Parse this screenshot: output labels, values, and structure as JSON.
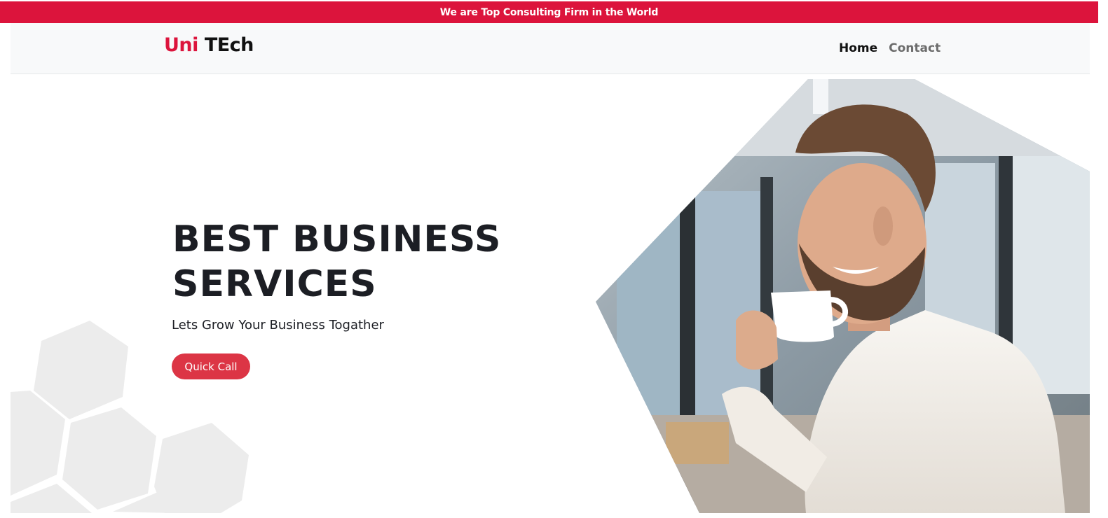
{
  "announcement": "We are Top Consulting Firm in the World",
  "brand": {
    "part1": "Uni",
    "part2": "TEch"
  },
  "nav": {
    "home": "Home",
    "contact": "Contact"
  },
  "hero": {
    "title_line1": "BEST BUSINESS",
    "title_line2": "SERVICES",
    "subtitle": "Lets Grow Your Business Togather",
    "cta_label": "Quick Call"
  },
  "colors": {
    "accent": "#dc143c",
    "button": "#dc3545",
    "navbar_bg": "#f8f9fa",
    "hex_bg": "#ececec"
  }
}
